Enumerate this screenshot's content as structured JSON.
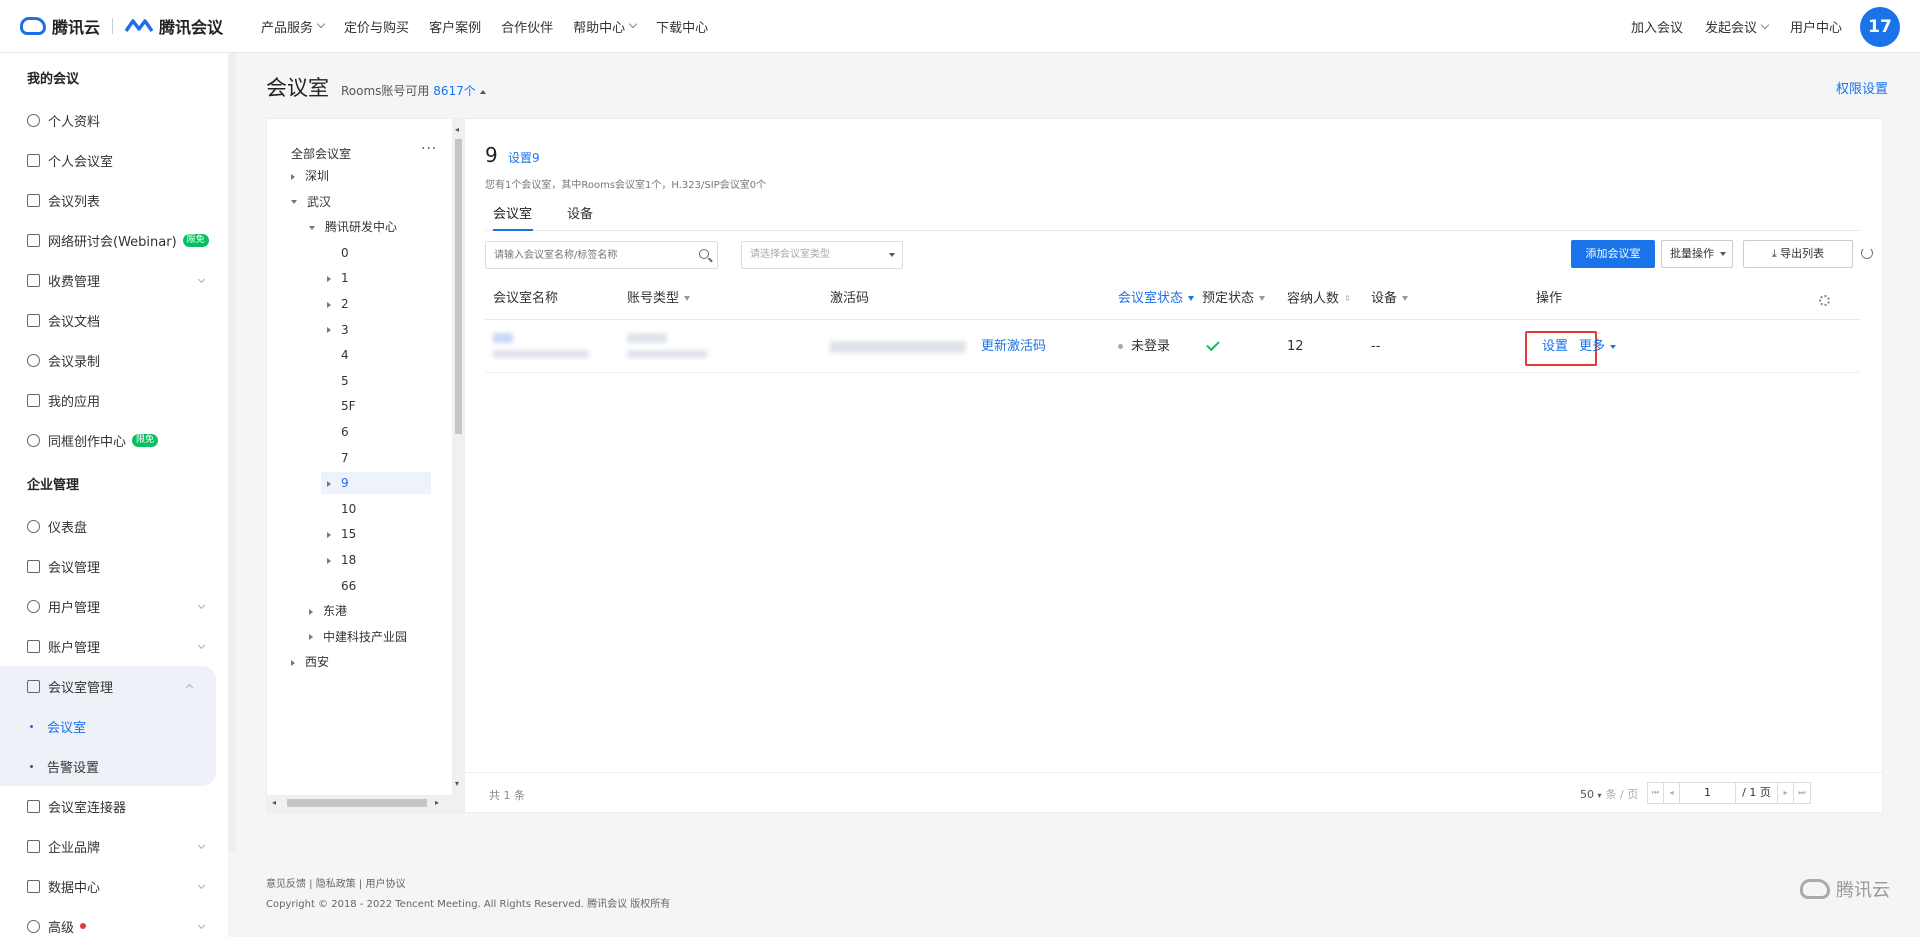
{
  "topbar": {
    "brand1": "腾讯云",
    "brand2": "腾讯会议",
    "nav": [
      {
        "label": "产品服务",
        "dropdown": true
      },
      {
        "label": "定价与购买",
        "dropdown": false
      },
      {
        "label": "客户案例",
        "dropdown": false
      },
      {
        "label": "合作伙伴",
        "dropdown": false
      },
      {
        "label": "帮助中心",
        "dropdown": true
      },
      {
        "label": "下载中心",
        "dropdown": false
      }
    ],
    "right": {
      "join": "加入会议",
      "start": "发起会议",
      "user_center": "用户中心",
      "avatar_text": "17"
    }
  },
  "sidebar": {
    "section_my": "我的会议",
    "my_items": [
      {
        "label": "个人资料"
      },
      {
        "label": "个人会议室"
      },
      {
        "label": "会议列表"
      },
      {
        "label": "网络研讨会(Webinar)",
        "badge": "限免"
      },
      {
        "label": "收费管理",
        "arrow": true
      },
      {
        "label": "会议文档"
      },
      {
        "label": "会议录制"
      },
      {
        "label": "我的应用"
      },
      {
        "label": "同框创作中心",
        "badge": "限免"
      }
    ],
    "section_ent": "企业管理",
    "ent_items_top": [
      {
        "label": "仪表盘"
      },
      {
        "label": "会议管理"
      },
      {
        "label": "用户管理",
        "arrow": true
      },
      {
        "label": "账户管理",
        "arrow": true
      }
    ],
    "room_mgmt": {
      "label": "会议室管理",
      "children": [
        {
          "label": "会议室",
          "active": true
        },
        {
          "label": "告警设置",
          "active": false
        }
      ]
    },
    "ent_items_bottom": [
      {
        "label": "会议室连接器"
      },
      {
        "label": "企业品牌",
        "arrow": true
      },
      {
        "label": "数据中心",
        "arrow": true
      },
      {
        "label": "高级",
        "arrow": true,
        "red_dot": true
      }
    ]
  },
  "page": {
    "title": "会议室",
    "rooms_prefix": "Rooms账号可用",
    "rooms_count": "8617个",
    "perm_link": "权限设置"
  },
  "tree": {
    "root": "全部会议室",
    "more": "···",
    "nodes": [
      {
        "label": "深圳",
        "level": 0,
        "caret": "closed"
      },
      {
        "label": "武汉",
        "level": 0,
        "caret": "open"
      },
      {
        "label": "腾讯研发中心",
        "level": 1,
        "caret": "open"
      },
      {
        "label": "0",
        "level": 2,
        "caret": "none"
      },
      {
        "label": "1",
        "level": 2,
        "caret": "closed"
      },
      {
        "label": "2",
        "level": 2,
        "caret": "closed"
      },
      {
        "label": "3",
        "level": 2,
        "caret": "closed"
      },
      {
        "label": "4",
        "level": 2,
        "caret": "none"
      },
      {
        "label": "5",
        "level": 2,
        "caret": "none"
      },
      {
        "label": "5F",
        "level": 2,
        "caret": "none"
      },
      {
        "label": "6",
        "level": 2,
        "caret": "none"
      },
      {
        "label": "7",
        "level": 2,
        "caret": "none"
      },
      {
        "label": "9",
        "level": 2,
        "caret": "closed",
        "selected": true
      },
      {
        "label": "10",
        "level": 2,
        "caret": "none"
      },
      {
        "label": "15",
        "level": 2,
        "caret": "closed"
      },
      {
        "label": "18",
        "level": 2,
        "caret": "closed"
      },
      {
        "label": "66",
        "level": 2,
        "caret": "none"
      },
      {
        "label": "东港",
        "level": 1,
        "caret": "closed"
      },
      {
        "label": "中建科技产业园",
        "level": 1,
        "caret": "closed"
      },
      {
        "label": "西安",
        "level": 0,
        "caret": "closed"
      }
    ]
  },
  "content": {
    "room_name": "9",
    "room_settings": "设置9",
    "desc": "您有1个会议室，其中Rooms会议室1个，H.323/SIP会议室0个",
    "tabs": [
      {
        "label": "会议室",
        "active": true
      },
      {
        "label": "设备",
        "active": false
      }
    ],
    "search_placeholder": "请输入会议室名称/标签名称",
    "type_placeholder": "请选择会议室类型",
    "btn_add": "添加会议室",
    "btn_batch": "批量操作",
    "btn_export": "导出列表",
    "columns": {
      "name": "会议室名称",
      "account_type": "账号类型",
      "activation": "激活码",
      "status": "会议室状态",
      "booking": "预定状态",
      "capacity": "容纳人数",
      "device": "设备",
      "action": "操作"
    },
    "rows": [
      {
        "renew": "更新激活码",
        "status": "未登录",
        "capacity": "12",
        "device": "--",
        "action_set": "设置",
        "action_more": "更多"
      }
    ],
    "total": "共 1 条",
    "per_page": "50",
    "per_page_unit": "条 / 页",
    "page_input": "1",
    "page_total": "/ 1 页"
  },
  "footer": {
    "links": "意见反馈 | 隐私政策 | 用户协议",
    "copyright": "Copyright © 2018 - 2022 Tencent Meeting. All Rights Reserved. 腾讯会议 版权所有",
    "logo": "腾讯云"
  },
  "colors": {
    "accent": "#1a73e8",
    "badge": "#07c160",
    "highlight_border": "#e53935"
  }
}
